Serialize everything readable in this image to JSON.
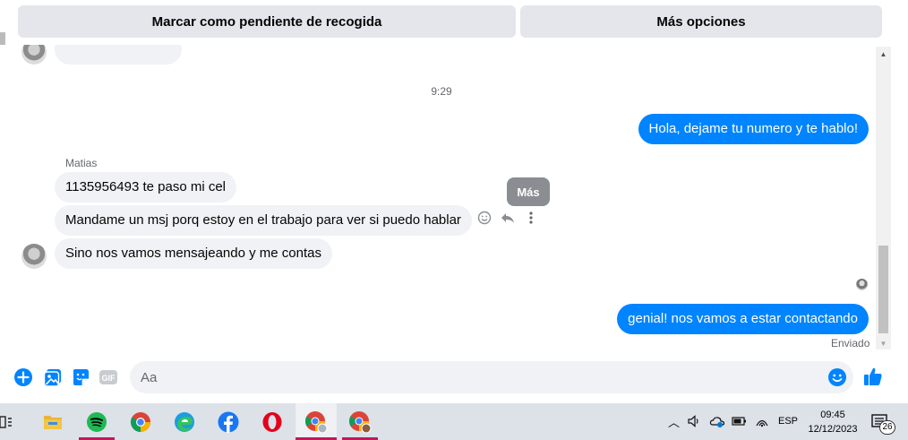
{
  "actions": {
    "mark_pending_label": "Marcar como pendiente de recogida",
    "more_options_label": "Más opciones"
  },
  "chat": {
    "timestamp": "9:29",
    "outgoing_1": "Hola, dejame tu numero y te hablo!",
    "sender_name": "Matias",
    "incoming_1": "1135956493 te paso mi cel",
    "incoming_2": "Mandame un msj porq estoy en el trabajo para ver si puedo hablar",
    "incoming_3": "Sino nos vamos mensajeando y me contas",
    "tooltip": "Más",
    "outgoing_2": "genial! nos vamos a estar contactando",
    "sent_status": "Enviado"
  },
  "composer": {
    "placeholder": "Aa",
    "accent": "#0084ff"
  },
  "taskbar": {
    "language": "ESP",
    "time": "09:45",
    "date": "12/12/2023",
    "notification_count": "26"
  }
}
